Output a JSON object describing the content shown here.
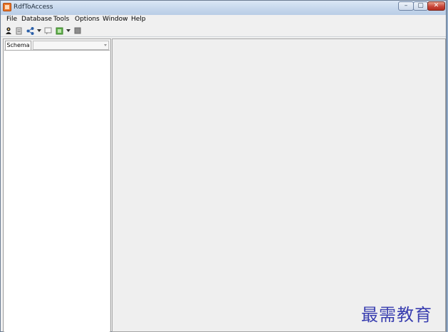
{
  "window": {
    "title": "RdfToAccess",
    "controls": {
      "minimize": "–",
      "maximize": "▢",
      "close": "✕"
    }
  },
  "menubar": {
    "items": [
      "File",
      "Database",
      "Tools",
      "Options",
      "Window",
      "Help"
    ]
  },
  "toolbar": {
    "icons": [
      "user-connect-icon",
      "document-icon",
      "share-icon",
      "chevron-down-icon",
      "comment-icon",
      "green-page-icon",
      "chevron-down-icon",
      "stop-icon"
    ]
  },
  "left_panel": {
    "tab_label": "Schema"
  },
  "watermark": "最需教育",
  "colors": {
    "accent": "#e8742a",
    "watermark": "#3a3fb0"
  }
}
